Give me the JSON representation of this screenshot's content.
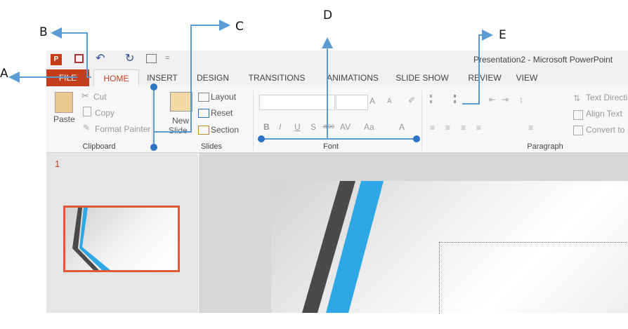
{
  "callouts": {
    "a": "A",
    "b": "B",
    "c": "C",
    "d": "D",
    "e": "E"
  },
  "window": {
    "title": "Presentation2 - Microsoft PowerPoint"
  },
  "qat": {
    "undo_icon": "undo-icon",
    "redo_icon": "redo-icon",
    "save_icon": "save-icon",
    "dropdown": "="
  },
  "tabs": [
    "FILE",
    "HOME",
    "INSERT",
    "DESIGN",
    "TRANSITIONS",
    "ANIMATIONS",
    "SLIDE SHOW",
    "REVIEW",
    "VIEW"
  ],
  "clipboard": {
    "paste": "Paste",
    "cut": "Cut",
    "copy": "Copy",
    "format_painter": "Format Painter",
    "label": "Clipboard"
  },
  "slides": {
    "new_slide": "New",
    "new_slide2": "Slide",
    "layout": "Layout",
    "reset": "Reset",
    "section": "Section",
    "label": "Slides"
  },
  "font": {
    "label": "Font",
    "bold": "B",
    "italic": "I",
    "underline": "U",
    "strike": "S",
    "abc": "abc",
    "spacing": "AV",
    "case": "Aa",
    "color": "A",
    "grow": "A",
    "shrink": "A"
  },
  "paragraph": {
    "label": "Paragraph",
    "text_direction": "Text Directi",
    "align_text": "Align Text",
    "convert": "Convert to"
  },
  "thumbnail": {
    "number": "1"
  },
  "colors": {
    "accent": "#c43e1c",
    "callout_line": "#5b9bd5",
    "slide_blue": "#2ea8e5",
    "slide_dark": "#4a4a4a"
  }
}
